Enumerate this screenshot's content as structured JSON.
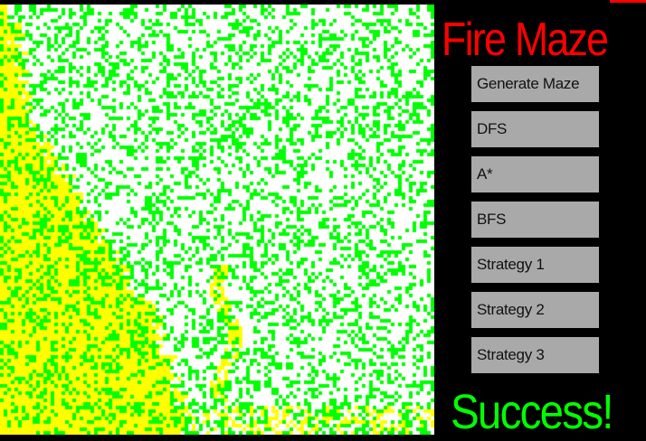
{
  "app": {
    "title": "Fire Maze",
    "status": "Success!"
  },
  "buttons": [
    {
      "label": "Generate Maze"
    },
    {
      "label": "DFS"
    },
    {
      "label": "A*"
    },
    {
      "label": "BFS"
    },
    {
      "label": "Strategy 1"
    },
    {
      "label": "Strategy 2"
    },
    {
      "label": "Strategy 3"
    }
  ],
  "colors": {
    "title": "#ff0000",
    "status": "#00ff00",
    "button_bg": "#a9a9a9",
    "panel_bg": "#000000",
    "maze_open": "#ffffff",
    "maze_wall": "#00ff00",
    "fire": "#ffff00",
    "corner_flag": "#ff0000"
  }
}
